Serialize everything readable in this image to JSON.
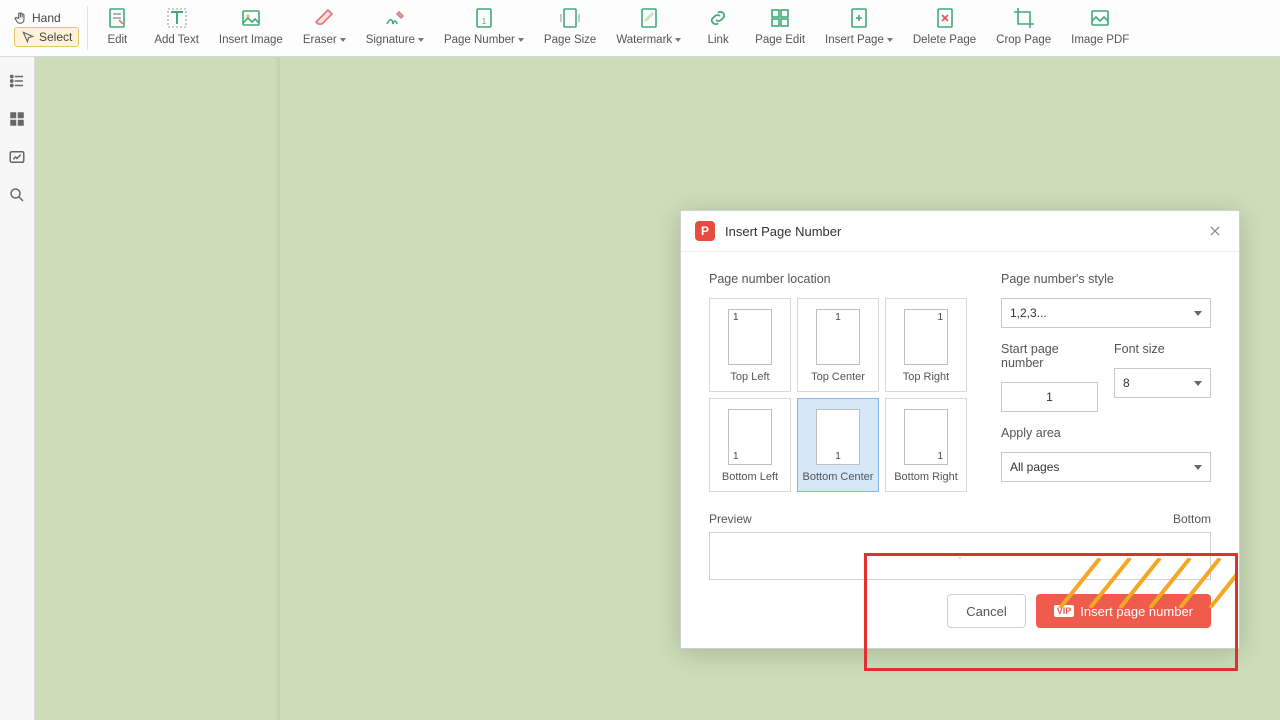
{
  "toolbar": {
    "hand": "Hand",
    "select": "Select",
    "edit": "Edit",
    "addText": "Add Text",
    "insertImage": "Insert Image",
    "eraser": "Eraser",
    "signature": "Signature",
    "pageNumber": "Page Number",
    "pageSize": "Page Size",
    "watermark": "Watermark",
    "link": "Link",
    "pageEdit": "Page Edit",
    "insertPage": "Insert Page",
    "deletePage": "Delete Page",
    "cropPage": "Crop Page",
    "imagePdf": "Image PDF"
  },
  "dialog": {
    "title": "Insert Page Number",
    "locLabel": "Page number location",
    "loc": {
      "tl": "Top Left",
      "tc": "Top Center",
      "tr": "Top Right",
      "bl": "Bottom Left",
      "bc": "Bottom Center",
      "br": "Bottom Right",
      "num": "1"
    },
    "styleLabel": "Page number's style",
    "styleValue": "1,2,3...",
    "startLabel": "Start page number",
    "startValue": "1",
    "fontLabel": "Font size",
    "fontValue": "8",
    "areaLabel": "Apply area",
    "areaValue": "All pages",
    "preview": "Preview",
    "bottom": "Bottom",
    "cancel": "Cancel",
    "insert": "Insert page number",
    "vip": "VIP"
  }
}
